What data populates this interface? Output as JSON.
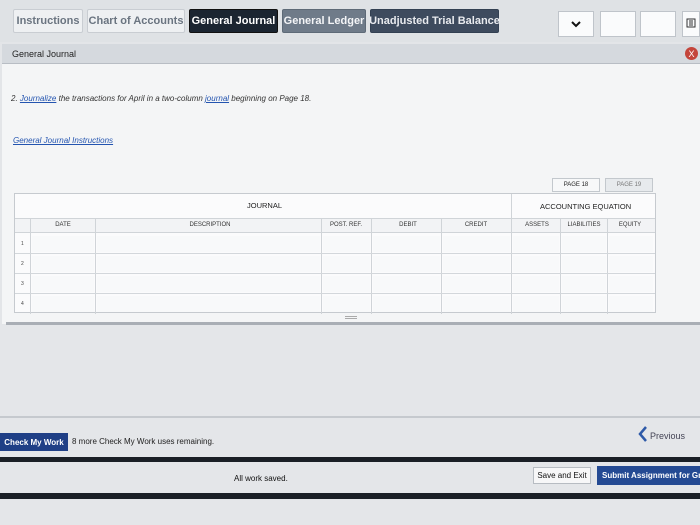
{
  "tabs": [
    {
      "label": "Instructions"
    },
    {
      "label": "Chart of Accounts"
    },
    {
      "label": "General Journal"
    },
    {
      "label": "General Ledger"
    },
    {
      "label": "Unadjusted Trial Balance"
    }
  ],
  "panel": {
    "title": "General Journal",
    "close_label": "X",
    "instruction_prefix": "2. ",
    "instruction_link1": "Journalize",
    "instruction_mid": " the transactions for April in a two-column ",
    "instruction_link2": "journal",
    "instruction_suffix": " beginning on Page 18.",
    "instructions_link": "General Journal Instructions"
  },
  "pages": {
    "current": "PAGE 18",
    "next": "PAGE 19"
  },
  "journal": {
    "title": "JOURNAL",
    "equation_title": "ACCOUNTING EQUATION",
    "columns": {
      "date": "DATE",
      "description": "DESCRIPTION",
      "post_ref": "POST. REF.",
      "debit": "DEBIT",
      "credit": "CREDIT",
      "assets": "ASSETS",
      "liabilities": "LIABILITIES",
      "equity": "EQUITY"
    },
    "rows": [
      "1",
      "2",
      "3",
      "4"
    ]
  },
  "footer": {
    "check_label": "Check My Work",
    "remaining": "8 more Check My Work uses remaining.",
    "previous": "Previous",
    "saved": "All work saved.",
    "save_exit": "Save and Exit",
    "submit": "Submit Assignment for Gra"
  }
}
